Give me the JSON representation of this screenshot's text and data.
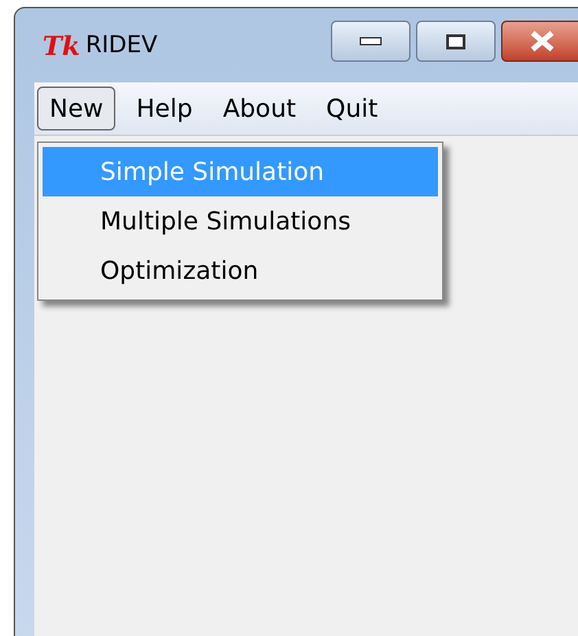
{
  "window": {
    "app_logo": "Tk",
    "title": "RIDEV"
  },
  "menu_bar": [
    {
      "label": "New",
      "selected": true
    },
    {
      "label": "Help",
      "selected": false
    },
    {
      "label": "About",
      "selected": false
    },
    {
      "label": "Quit",
      "selected": false
    }
  ],
  "dropdown": {
    "items": [
      {
        "label": "Simple Simulation",
        "selected": true
      },
      {
        "label": "Multiple Simulations",
        "selected": false
      },
      {
        "label": "Optimization",
        "selected": false
      }
    ]
  }
}
